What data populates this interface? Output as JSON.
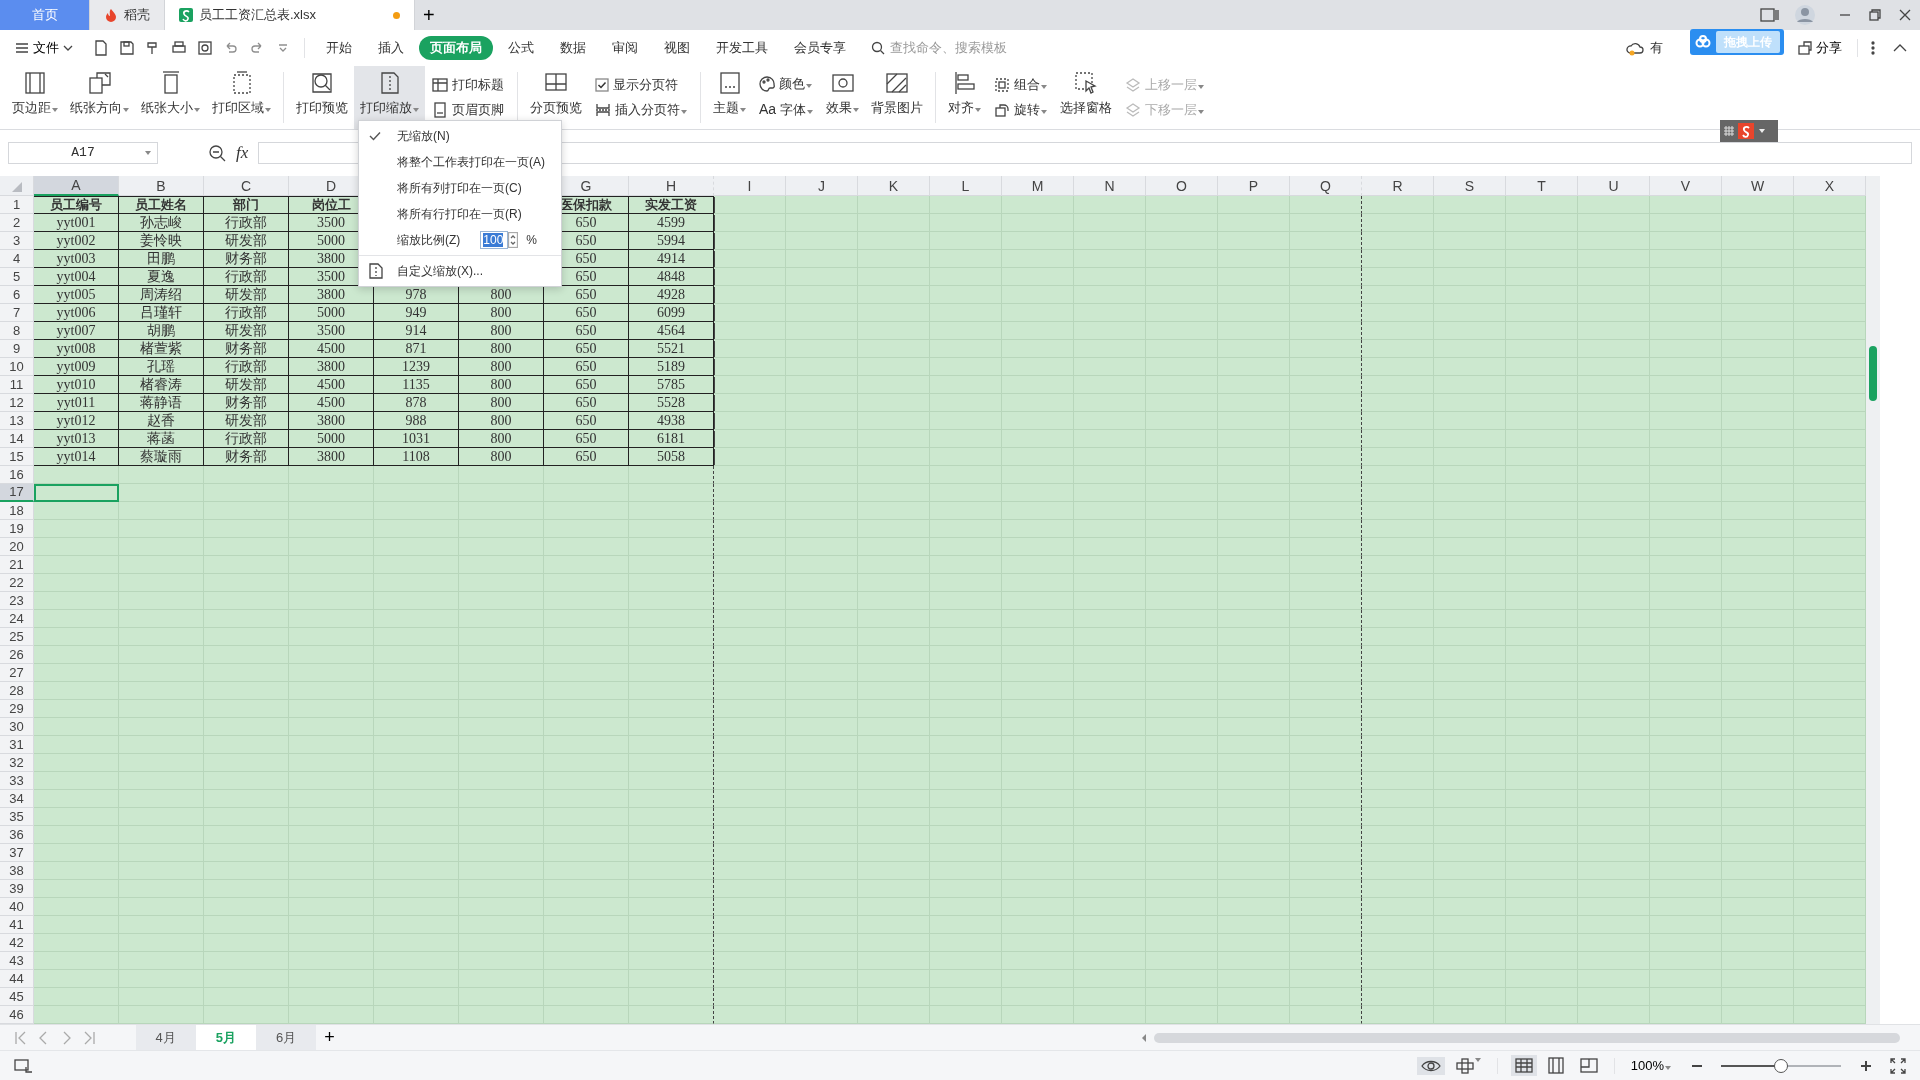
{
  "title_tabs": [
    {
      "kind": "home",
      "label": "首页",
      "selected": false,
      "modified": false
    },
    {
      "kind": "docer",
      "label": "稻壳",
      "selected": false,
      "modified": false
    },
    {
      "kind": "sheet",
      "label": "员工工资汇总表.xlsx",
      "selected": true,
      "modified": true
    }
  ],
  "new_tab": "+",
  "menu_bar": {
    "file_label": "文件",
    "tabs": [
      {
        "label": "开始",
        "selected": false
      },
      {
        "label": "插入",
        "selected": false
      },
      {
        "label": "页面布局",
        "selected": true
      },
      {
        "label": "公式",
        "selected": false
      },
      {
        "label": "数据",
        "selected": false
      },
      {
        "label": "审阅",
        "selected": false
      },
      {
        "label": "视图",
        "selected": false
      },
      {
        "label": "开发工具",
        "selected": false
      },
      {
        "label": "会员专享",
        "selected": false
      }
    ],
    "search": {
      "placeholder": "查找命令、搜索模板"
    },
    "cloud_label": "有",
    "upload_label": "拖拽上传",
    "share_label": "分享"
  },
  "ribbon": [
    {
      "kind": "large",
      "label": "页边距",
      "dropdown": true,
      "pressed": false
    },
    {
      "kind": "large",
      "label": "纸张方向",
      "dropdown": true,
      "pressed": false
    },
    {
      "kind": "large",
      "label": "纸张大小",
      "dropdown": true,
      "pressed": false
    },
    {
      "kind": "large",
      "label": "打印区域",
      "dropdown": true,
      "pressed": false
    },
    {
      "kind": "separator"
    },
    {
      "kind": "large",
      "label": "打印预览",
      "dropdown": false,
      "pressed": false
    },
    {
      "kind": "large",
      "label": "打印缩放",
      "dropdown": true,
      "pressed": true
    },
    {
      "kind": "stack",
      "items": [
        {
          "kind": "button",
          "label": "打印标题",
          "dropdown": false,
          "disabled": false
        },
        {
          "kind": "button",
          "label": "页眉页脚",
          "dropdown": false,
          "disabled": false
        }
      ]
    },
    {
      "kind": "separator"
    },
    {
      "kind": "large",
      "label": "分页预览",
      "dropdown": false,
      "pressed": false
    },
    {
      "kind": "stack",
      "items": [
        {
          "kind": "check",
          "label": "显示分页符",
          "checked": true,
          "dropdown": false,
          "disabled": false
        },
        {
          "kind": "button",
          "label": "插入分页符",
          "dropdown": true,
          "disabled": false
        }
      ]
    },
    {
      "kind": "separator"
    },
    {
      "kind": "large",
      "label": "主题",
      "dropdown": true,
      "pressed": false
    },
    {
      "kind": "stack",
      "items": [
        {
          "kind": "button",
          "label": "颜色",
          "dropdown": true,
          "disabled": false
        },
        {
          "kind": "glyph",
          "glyph": "Aa",
          "label": "字体",
          "dropdown": true,
          "disabled": false
        }
      ]
    },
    {
      "kind": "large",
      "label": "效果",
      "dropdown": true,
      "pressed": false
    },
    {
      "kind": "large",
      "label": "背景图片",
      "dropdown": false,
      "pressed": false
    },
    {
      "kind": "separator"
    },
    {
      "kind": "large",
      "label": "对齐",
      "dropdown": true,
      "pressed": false
    },
    {
      "kind": "stack",
      "items": [
        {
          "kind": "button",
          "label": "组合",
          "dropdown": true,
          "disabled": false
        },
        {
          "kind": "button",
          "label": "旋转",
          "dropdown": true,
          "disabled": false
        }
      ]
    },
    {
      "kind": "large",
      "label": "选择窗格",
      "dropdown": false,
      "pressed": false
    },
    {
      "kind": "stack",
      "items": [
        {
          "kind": "button",
          "label": "上移一层",
          "dropdown": true,
          "disabled": true
        },
        {
          "kind": "button",
          "label": "下移一层",
          "dropdown": true,
          "disabled": true
        }
      ]
    }
  ],
  "formula_bar": {
    "name_box": "A17",
    "fx": "fx"
  },
  "columns": [
    {
      "letter": "A",
      "selected": true,
      "page_break": false
    },
    {
      "letter": "B",
      "selected": false,
      "page_break": false
    },
    {
      "letter": "C",
      "selected": false,
      "page_break": false
    },
    {
      "letter": "D",
      "selected": false,
      "page_break": false
    },
    {
      "selected": false,
      "page_break": false
    },
    {
      "selected": false,
      "page_break": false
    },
    {
      "letter": "G",
      "selected": false,
      "page_break": false
    },
    {
      "letter": "H",
      "selected": false,
      "page_break": true
    },
    {
      "letter": "I",
      "selected": false,
      "page_break": false
    },
    {
      "letter": "J",
      "selected": false,
      "page_break": false
    },
    {
      "letter": "K",
      "selected": false,
      "page_break": false
    },
    {
      "letter": "L",
      "selected": false,
      "page_break": false
    },
    {
      "letter": "M",
      "selected": false,
      "page_break": false
    },
    {
      "letter": "N",
      "selected": false,
      "page_break": false
    },
    {
      "letter": "O",
      "selected": false,
      "page_break": false
    },
    {
      "letter": "P",
      "selected": false,
      "page_break": false
    },
    {
      "letter": "Q",
      "selected": false,
      "page_break": true
    },
    {
      "letter": "R",
      "selected": false,
      "page_break": false
    },
    {
      "letter": "S",
      "selected": false,
      "page_break": false
    },
    {
      "letter": "T",
      "selected": false,
      "page_break": false
    },
    {
      "letter": "U",
      "selected": false,
      "page_break": false
    },
    {
      "letter": "V",
      "selected": false,
      "page_break": false
    },
    {
      "letter": "W",
      "selected": false,
      "page_break": false
    },
    {
      "letter": "X",
      "selected": false,
      "page_break": false
    }
  ],
  "rows": [
    {
      "number": "1",
      "kind": "header",
      "selected": false,
      "cells": [
        "员工编号",
        "员工姓名",
        "部门",
        "岗位工",
        null,
        null,
        "医保扣款",
        "实发工资"
      ]
    },
    {
      "number": "2",
      "kind": "data",
      "selected": false,
      "cells": [
        "yyt001",
        "孙志峻",
        "行政部",
        "3500",
        null,
        null,
        "650",
        "4599"
      ]
    },
    {
      "number": "3",
      "kind": "data",
      "selected": false,
      "cells": [
        "yyt002",
        "姜怜映",
        "研发部",
        "5000",
        null,
        null,
        "650",
        "5994"
      ]
    },
    {
      "number": "4",
      "kind": "data",
      "selected": false,
      "cells": [
        "yyt003",
        "田鹏",
        "财务部",
        "3800",
        null,
        null,
        "650",
        "4914"
      ]
    },
    {
      "number": "5",
      "kind": "data",
      "selected": false,
      "cells": [
        "yyt004",
        "夏逸",
        "行政部",
        "3500",
        null,
        null,
        "650",
        "4848"
      ]
    },
    {
      "number": "6",
      "kind": "data",
      "selected": false,
      "cells": [
        "yyt005",
        "周涛绍",
        "研发部",
        "3800",
        "978",
        "800",
        "650",
        "4928"
      ]
    },
    {
      "number": "7",
      "kind": "data",
      "selected": false,
      "cells": [
        "yyt006",
        "吕瑾轩",
        "行政部",
        "5000",
        "949",
        "800",
        "650",
        "6099"
      ]
    },
    {
      "number": "8",
      "kind": "data",
      "selected": false,
      "cells": [
        "yyt007",
        "胡鹏",
        "研发部",
        "3500",
        "914",
        "800",
        "650",
        "4564"
      ]
    },
    {
      "number": "9",
      "kind": "data",
      "selected": false,
      "cells": [
        "yyt008",
        "楮萱紫",
        "财务部",
        "4500",
        "871",
        "800",
        "650",
        "5521"
      ]
    },
    {
      "number": "10",
      "kind": "data",
      "selected": false,
      "cells": [
        "yyt009",
        "孔瑶",
        "行政部",
        "3800",
        "1239",
        "800",
        "650",
        "5189"
      ]
    },
    {
      "number": "11",
      "kind": "data",
      "selected": false,
      "cells": [
        "yyt010",
        "楮睿涛",
        "研发部",
        "4500",
        "1135",
        "800",
        "650",
        "5785"
      ]
    },
    {
      "number": "12",
      "kind": "data",
      "selected": false,
      "cells": [
        "yyt011",
        "蒋静语",
        "财务部",
        "4500",
        "878",
        "800",
        "650",
        "5528"
      ]
    },
    {
      "number": "13",
      "kind": "data",
      "selected": false,
      "cells": [
        "yyt012",
        "赵香",
        "研发部",
        "3800",
        "988",
        "800",
        "650",
        "4938"
      ]
    },
    {
      "number": "14",
      "kind": "data",
      "selected": false,
      "cells": [
        "yyt013",
        "蒋菡",
        "行政部",
        "5000",
        "1031",
        "800",
        "650",
        "6181"
      ]
    },
    {
      "number": "15",
      "kind": "data",
      "selected": false,
      "cells": [
        "yyt014",
        "蔡璇雨",
        "财务部",
        "3800",
        "1108",
        "800",
        "650",
        "5058"
      ]
    },
    {
      "number": "16",
      "kind": "empty",
      "selected": false
    },
    {
      "number": "17",
      "kind": "empty",
      "selected": true
    },
    {
      "number": "18",
      "kind": "empty",
      "selected": false
    },
    {
      "number": "19",
      "kind": "empty",
      "selected": false
    },
    {
      "number": "20",
      "kind": "empty",
      "selected": false
    },
    {
      "number": "21",
      "kind": "empty",
      "selected": false
    },
    {
      "number": "22",
      "kind": "empty",
      "selected": false
    },
    {
      "number": "23",
      "kind": "empty",
      "selected": false
    },
    {
      "number": "24",
      "kind": "empty",
      "selected": false
    },
    {
      "number": "25",
      "kind": "empty",
      "selected": false
    },
    {
      "number": "26",
      "kind": "empty",
      "selected": false
    },
    {
      "number": "27",
      "kind": "empty",
      "selected": false
    },
    {
      "number": "28",
      "kind": "empty",
      "selected": false
    },
    {
      "number": "29",
      "kind": "empty",
      "selected": false
    },
    {
      "number": "30",
      "kind": "empty",
      "selected": false
    },
    {
      "number": "31",
      "kind": "empty",
      "selected": false
    },
    {
      "number": "32",
      "kind": "empty",
      "selected": false
    },
    {
      "number": "33",
      "kind": "empty",
      "selected": false
    },
    {
      "number": "34",
      "kind": "empty",
      "selected": false
    },
    {
      "number": "35",
      "kind": "empty",
      "selected": false
    },
    {
      "number": "36",
      "kind": "empty",
      "selected": false
    },
    {
      "number": "37",
      "kind": "empty",
      "selected": false
    },
    {
      "number": "38",
      "kind": "empty",
      "selected": false
    },
    {
      "number": "39",
      "kind": "empty",
      "selected": false
    },
    {
      "number": "40",
      "kind": "empty",
      "selected": false
    },
    {
      "number": "41",
      "kind": "empty",
      "selected": false
    },
    {
      "number": "42",
      "kind": "empty",
      "selected": false
    },
    {
      "number": "43",
      "kind": "empty",
      "selected": false
    },
    {
      "number": "44",
      "kind": "empty",
      "selected": false
    },
    {
      "number": "45",
      "kind": "empty",
      "selected": false
    },
    {
      "number": "46",
      "kind": "empty",
      "selected": false
    }
  ],
  "print_scale_menu": {
    "items": [
      {
        "kind": "option",
        "label": "无缩放(N)",
        "checked": true
      },
      {
        "kind": "option",
        "label": "将整个工作表打印在一页(A)",
        "checked": false
      },
      {
        "kind": "option",
        "label": "将所有列打印在一页(C)",
        "checked": false
      },
      {
        "kind": "option",
        "label": "将所有行打印在一页(R)",
        "checked": false
      },
      {
        "kind": "scale",
        "label": "缩放比例(Z)",
        "value": "100",
        "unit": "%"
      },
      {
        "kind": "custom",
        "label": "自定义缩放(X)..."
      }
    ]
  },
  "sheet_tabs": [
    {
      "label": "4月",
      "selected": false
    },
    {
      "label": "5月",
      "selected": true
    },
    {
      "label": "6月",
      "selected": false
    }
  ],
  "add_sheet": "+",
  "status_bar": {
    "view_modes": [
      {
        "selected": true
      },
      {
        "selected": false
      },
      {
        "selected": false
      }
    ],
    "zoom": "100%",
    "zoom_slider": {
      "level": 0.5
    }
  }
}
